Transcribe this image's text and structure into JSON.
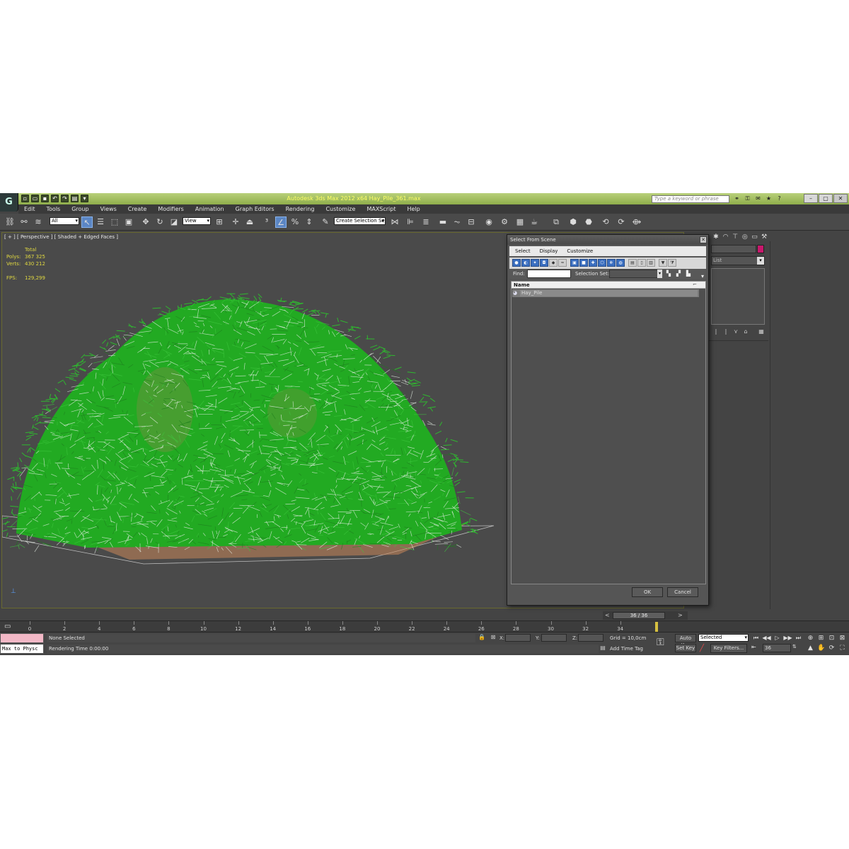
{
  "titlebar": {
    "title": "Autodesk 3ds Max  2012 x64      Hay_Pile_361.max",
    "search_placeholder": "Type a keyword or phrase",
    "logo": "3ds-max-logo-icon",
    "quick_access_icons": [
      "new-icon",
      "open-icon",
      "save-icon",
      "undo-icon",
      "redo-icon",
      "project-folder-icon",
      "dropdown-icon"
    ],
    "info_icons": [
      "binoculars-icon",
      "subscription-icon",
      "communication-icon",
      "favorites-icon",
      "help-icon"
    ],
    "window_controls": [
      "minimize",
      "maximize",
      "close"
    ]
  },
  "menu": {
    "items": [
      "Edit",
      "Tools",
      "Group",
      "Views",
      "Create",
      "Modifiers",
      "Animation",
      "Graph Editors",
      "Rendering",
      "Customize",
      "MAXScript",
      "Help"
    ]
  },
  "toolbar": {
    "selection_filter": "All",
    "ref_coord": "View",
    "named_selection": "Create Selection Se"
  },
  "viewport": {
    "label": "[ + ] [ Perspective ] [ Shaded + Edged Faces ]",
    "stats": {
      "header": "Total",
      "polys_label": "Polys:",
      "polys_value": "367 325",
      "verts_label": "Verts:",
      "verts_value": "430 212",
      "fps_label": "FPS:",
      "fps_value": "129,299"
    },
    "hay_color": "#22aa22",
    "ground_color": "#c8875a"
  },
  "command_panel": {
    "modifier_list": "List",
    "object_color": "#c8186c"
  },
  "dialog": {
    "title": "Select From Scene",
    "menu": [
      "Select",
      "Display",
      "Customize"
    ],
    "find_label": "Find:",
    "selection_set_label": "Selection Set:",
    "column_header": "Name",
    "items": [
      "Hay_Pile"
    ],
    "ok_label": "OK",
    "cancel_label": "Cancel"
  },
  "timeline": {
    "current_frame": 36,
    "total_frames": 36,
    "slider_label": "36 / 36",
    "ticks": [
      "0",
      "2",
      "4",
      "6",
      "8",
      "10",
      "12",
      "14",
      "16",
      "18",
      "20",
      "22",
      "24",
      "26",
      "28",
      "30",
      "32",
      "34"
    ]
  },
  "status": {
    "maxscript_text": "Max to Physc",
    "prompt": "None Selected",
    "status_line": "Rendering Time  0:00:00",
    "x_label": "X:",
    "y_label": "Y:",
    "z_label": "Z:",
    "grid": "Grid = 10,0cm",
    "add_time_tag": "Add Time Tag",
    "auto_key": "Auto Key",
    "set_key": "Set Key",
    "key_mode": "Selected",
    "key_filters": "Key Filters...",
    "frame_value": "36"
  }
}
